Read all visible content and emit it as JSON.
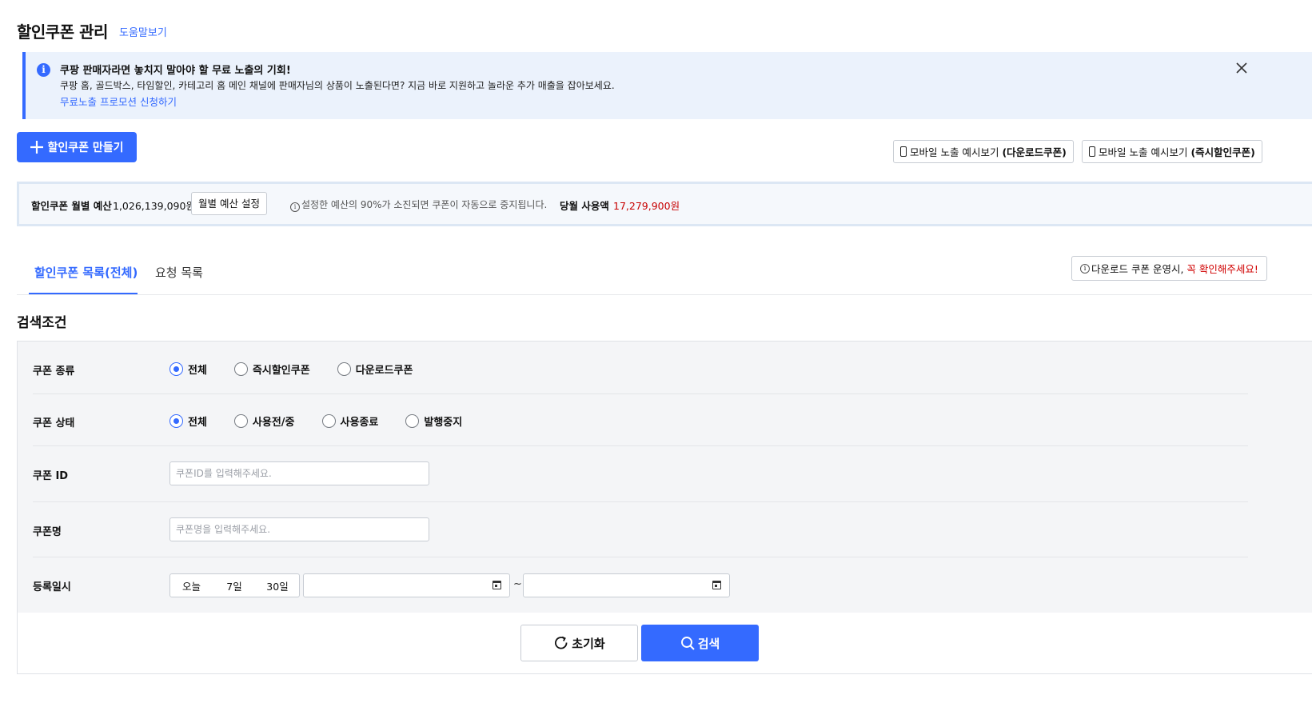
{
  "header": {
    "title": "할인쿠폰 관리",
    "help_link": "도움말보기"
  },
  "notice": {
    "icon": "info-icon",
    "title": "쿠팡 판매자라면 놓치지 말아야 할 무료 노출의 기회!",
    "body": "쿠팡 홈, 골드박스, 타임할인, 카테고리 홈 메인 채널에 판매자님의 상품이 노출된다면? 지금 바로 지원하고 놀라운 추가 매출을 잡아보세요.",
    "link": "무료노출 프로모션 신청하기",
    "close_icon": "close-icon"
  },
  "actions": {
    "create_label": "할인쿠폰 만들기",
    "preview_download_prefix": "모바일 노출 예시보기",
    "preview_download_bold": "(다운로드쿠폰)",
    "preview_instant_prefix": "모바일 노출 예시보기",
    "preview_instant_bold": "(즉시할인쿠폰)"
  },
  "budget": {
    "label": "할인쿠폰 월별 예산",
    "value": "1,026,139,090원",
    "set_button": "월별 예산 설정",
    "note": "설정한 예산의 90%가 소진되면 쿠폰이 자동으로 중지됩니다.",
    "used_label": "당월 사용액",
    "used_value": "17,279,900원"
  },
  "tabs": {
    "active": "할인쿠폰 목록(전체)",
    "inactive": "요청 목록",
    "notice_prefix": "다운로드 쿠폰 운영시,",
    "notice_red": "꼭 확인해주세요!"
  },
  "search": {
    "section_title": "검색조건",
    "coupon_type": {
      "label": "쿠폰 종류",
      "options": [
        "전체",
        "즉시할인쿠폰",
        "다운로드쿠폰"
      ],
      "selected": "전체"
    },
    "coupon_status": {
      "label": "쿠폰 상태",
      "options": [
        "전체",
        "사용전/중",
        "사용종료",
        "발행중지"
      ],
      "selected": "전체"
    },
    "coupon_id": {
      "label": "쿠폰 ID",
      "placeholder": "쿠폰ID를 입력해주세요."
    },
    "coupon_name": {
      "label": "쿠폰명",
      "placeholder": "쿠폰명을 입력해주세요."
    },
    "reg_date": {
      "label": "등록일시",
      "quick": [
        "오늘",
        "7일",
        "30일"
      ],
      "separator": "~"
    },
    "reset_label": "초기화",
    "search_label": "검색"
  },
  "colors": {
    "accent": "#346aff",
    "danger": "#c70000",
    "notice_bg": "#ebf2fc"
  }
}
